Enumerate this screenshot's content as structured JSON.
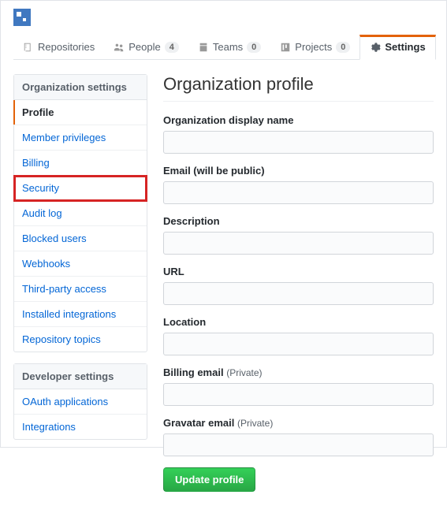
{
  "tabs": [
    {
      "label": "Repositories"
    },
    {
      "label": "People",
      "count": "4"
    },
    {
      "label": "Teams",
      "count": "0"
    },
    {
      "label": "Projects",
      "count": "0"
    },
    {
      "label": "Settings"
    }
  ],
  "sidebar": {
    "orgHeader": "Organization settings",
    "org": [
      "Profile",
      "Member privileges",
      "Billing",
      "Security",
      "Audit log",
      "Blocked users",
      "Webhooks",
      "Third-party access",
      "Installed integrations",
      "Repository topics"
    ],
    "devHeader": "Developer settings",
    "dev": [
      "OAuth applications",
      "Integrations"
    ]
  },
  "main": {
    "title": "Organization profile",
    "fields": [
      {
        "label": "Organization display name",
        "value": ""
      },
      {
        "label": "Email (will be public)",
        "value": ""
      },
      {
        "label": "Description",
        "value": ""
      },
      {
        "label": "URL",
        "value": ""
      },
      {
        "label": "Location",
        "value": ""
      },
      {
        "label": "Billing email",
        "note": "(Private)",
        "value": ""
      },
      {
        "label": "Gravatar email",
        "note": "(Private)",
        "value": ""
      }
    ],
    "submit": "Update profile"
  }
}
